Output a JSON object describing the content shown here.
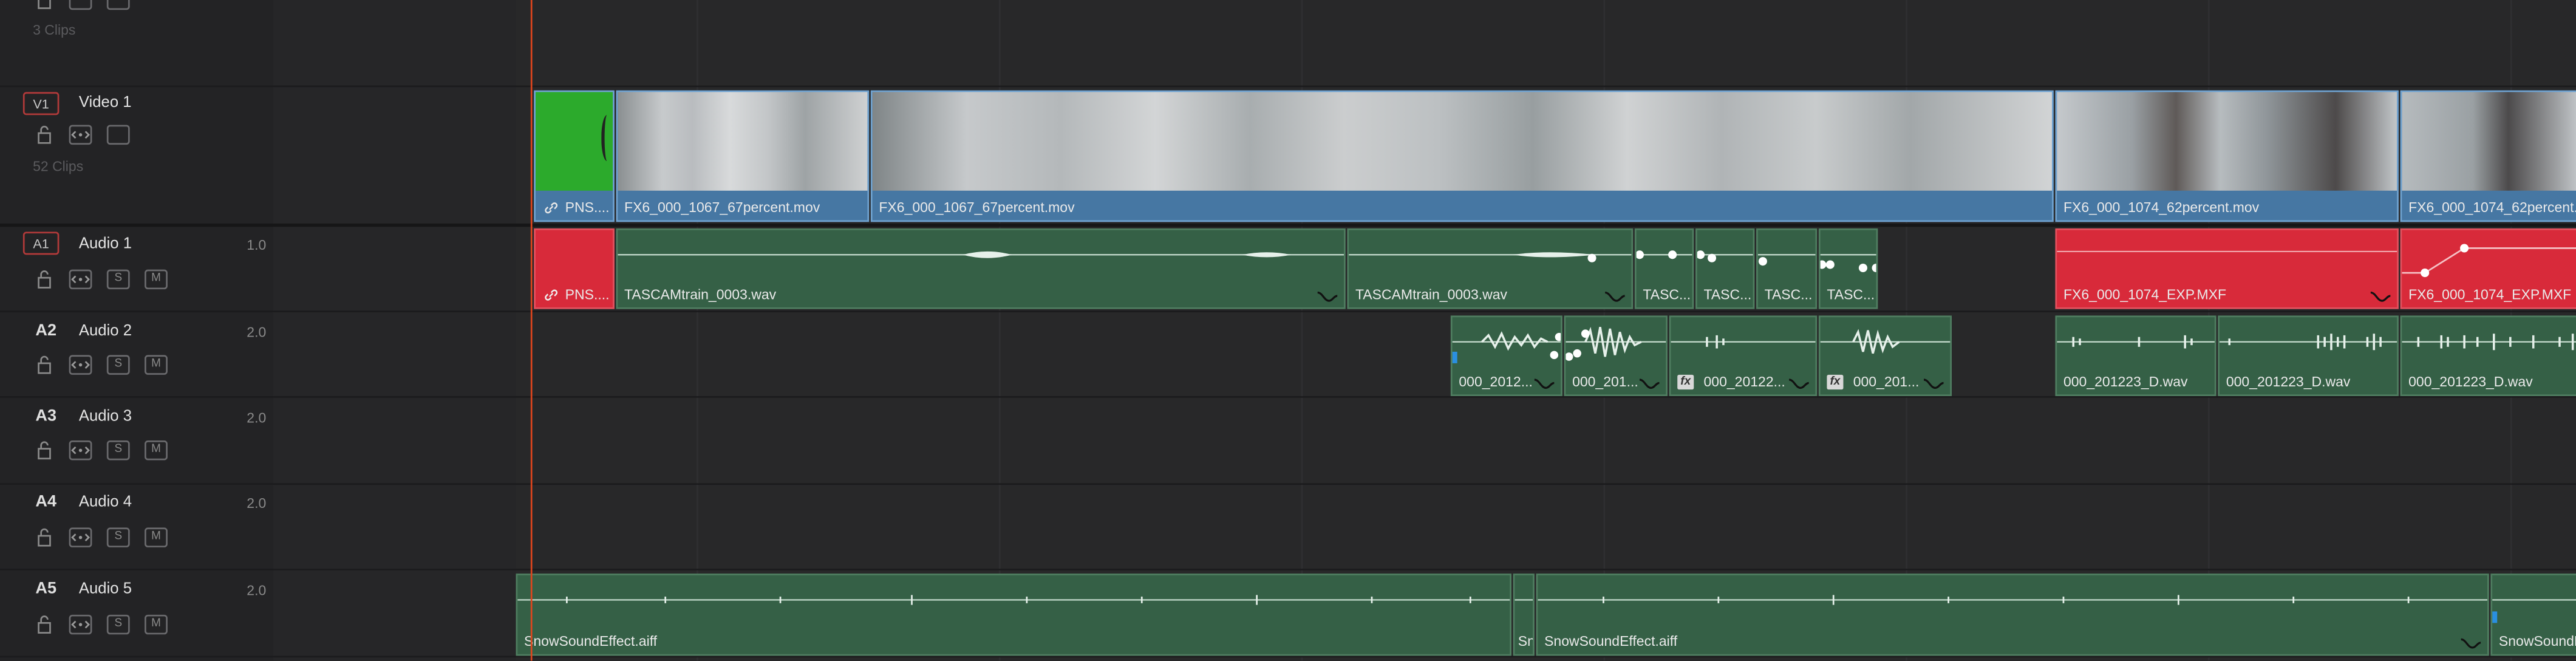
{
  "tracks": {
    "top": {
      "clips": "3 Clips"
    },
    "video1": {
      "id": "V1",
      "name": "Video 1",
      "clips": "52 Clips"
    },
    "audio1": {
      "id": "A1",
      "name": "Audio 1",
      "vol": "1.0"
    },
    "audio2": {
      "id": "A2",
      "name": "Audio 2",
      "vol": "2.0"
    },
    "audio3": {
      "id": "A3",
      "name": "Audio 3",
      "vol": "2.0"
    },
    "audio4": {
      "id": "A4",
      "name": "Audio 4",
      "vol": "2.0"
    },
    "audio5": {
      "id": "A5",
      "name": "Audio 5",
      "vol": "2.0"
    }
  },
  "controls": {
    "solo": "S",
    "mute": "M"
  },
  "video_clips": [
    "PNS....",
    "FX6_000_1067_67percent.mov",
    "FX6_000_1067_67percent.mov",
    "FX6_000_1074_62percent.mov",
    "FX6_000_1074_62percent.mov"
  ],
  "a1_clips": [
    "PNS....",
    "TASCAMtrain_0003.wav",
    "TASCAMtrain_0003.wav",
    "TASC...",
    "TASC...",
    "TASC...",
    "TASC...",
    "FX6_000_1074_EXP.MXF",
    "FX6_000_1074_EXP.MXF"
  ],
  "a2_clips": [
    "000_2012...",
    "000_201...",
    "000_20122...",
    "000_201...",
    "000_201223_D.wav",
    "000_201223_D.wav",
    "000_201223_D.wav"
  ],
  "a5_clips": [
    "SnowSoundEffect.aiff",
    "Sn",
    "SnowSoundEffect.aiff",
    "SnowSoundE"
  ],
  "fx_label": "fx",
  "colors": {
    "playhead": "#e0451d",
    "video_clip": "#4677a3",
    "audio_clip": "#356046",
    "audio_clip_red": "#d82a3a",
    "selected_track": "#b23a3a"
  }
}
